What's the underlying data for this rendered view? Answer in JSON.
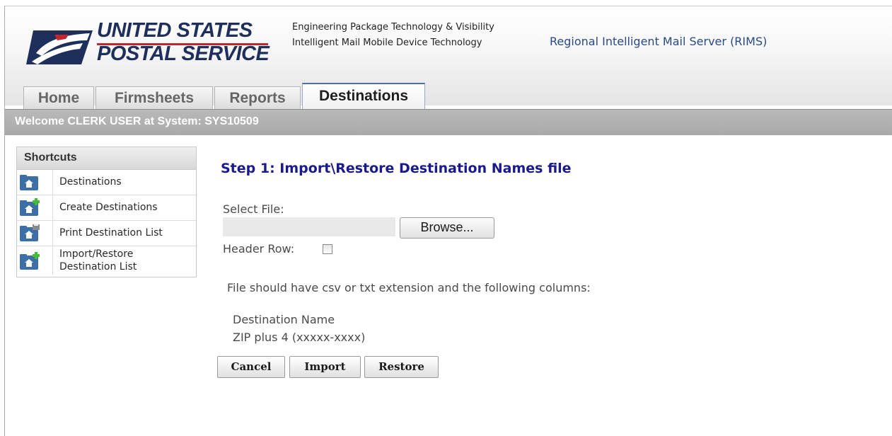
{
  "header": {
    "brand_line1": "UNITED STATES",
    "brand_line2": "POSTAL SERVICE",
    "subtitle1": "Engineering Package Technology & Visibility",
    "subtitle2": "Intelligent Mail Mobile Device Technology",
    "app_name": "Regional Intelligent Mail Server (RIMS)"
  },
  "tabs": [
    {
      "label": "Home"
    },
    {
      "label": "Firmsheets"
    },
    {
      "label": "Reports"
    },
    {
      "label": "Destinations",
      "active": true
    }
  ],
  "welcome": "Welcome CLERK USER at System: SYS10509",
  "shortcuts": {
    "title": "Shortcuts",
    "items": [
      {
        "label": "Destinations",
        "icon": "house-folder-icon"
      },
      {
        "label": "Create Destinations",
        "icon": "house-folder-add-icon"
      },
      {
        "label": "Print Destination List",
        "icon": "house-folder-print-icon"
      },
      {
        "label": "Import/Restore Destination List",
        "icon": "house-folder-add-icon"
      }
    ]
  },
  "main": {
    "step_title": "Step 1: Import\\Restore Destination Names file",
    "select_file_label": "Select File:",
    "file_value": "",
    "browse_label": "Browse...",
    "header_row_label": "Header Row:",
    "header_row_checked": false,
    "info_text": "File should have csv or txt extension and the following columns:",
    "columns": [
      "Destination Name",
      "ZIP plus 4 (xxxxx-xxxx)"
    ],
    "buttons": {
      "cancel": "Cancel",
      "import": "Import",
      "restore": "Restore"
    }
  },
  "colors": {
    "brand_blue": "#1f2f5b",
    "brand_red": "#c3262e",
    "title_blue": "#1a1a8e",
    "bar_gray": "#aaaaaa"
  }
}
